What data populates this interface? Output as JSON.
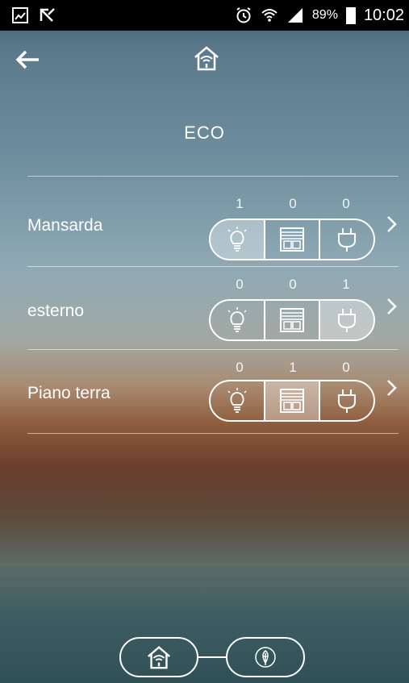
{
  "status_bar": {
    "icons_left": [
      "gallery-icon",
      "missed-call-icon"
    ],
    "icons_right": [
      "alarm-icon",
      "wifi-icon",
      "signal-icon",
      "battery-icon"
    ],
    "battery": "89%",
    "time": "10:02"
  },
  "app_bar": {
    "back_icon": "arrow-left-icon",
    "logo_icon": "home-wifi-icon"
  },
  "mode_title": "ECO",
  "device_types": [
    "light",
    "shutter",
    "plug"
  ],
  "rooms": [
    {
      "name": "Mansarda",
      "counts": [
        "1",
        "0",
        "0"
      ],
      "active": "light"
    },
    {
      "name": "esterno",
      "counts": [
        "0",
        "0",
        "1"
      ],
      "active": "plug"
    },
    {
      "name": "Piano terra",
      "counts": [
        "0",
        "1",
        "0"
      ],
      "active": "shutter"
    }
  ],
  "bottom_nav": {
    "home_icon": "home-wifi-icon",
    "eco_icon": "leaf-icon"
  },
  "colors": {
    "statusbar_bg": "#000000",
    "foreground": "#ffffff",
    "active_segment": "rgba(255,255,255,0.35)"
  }
}
